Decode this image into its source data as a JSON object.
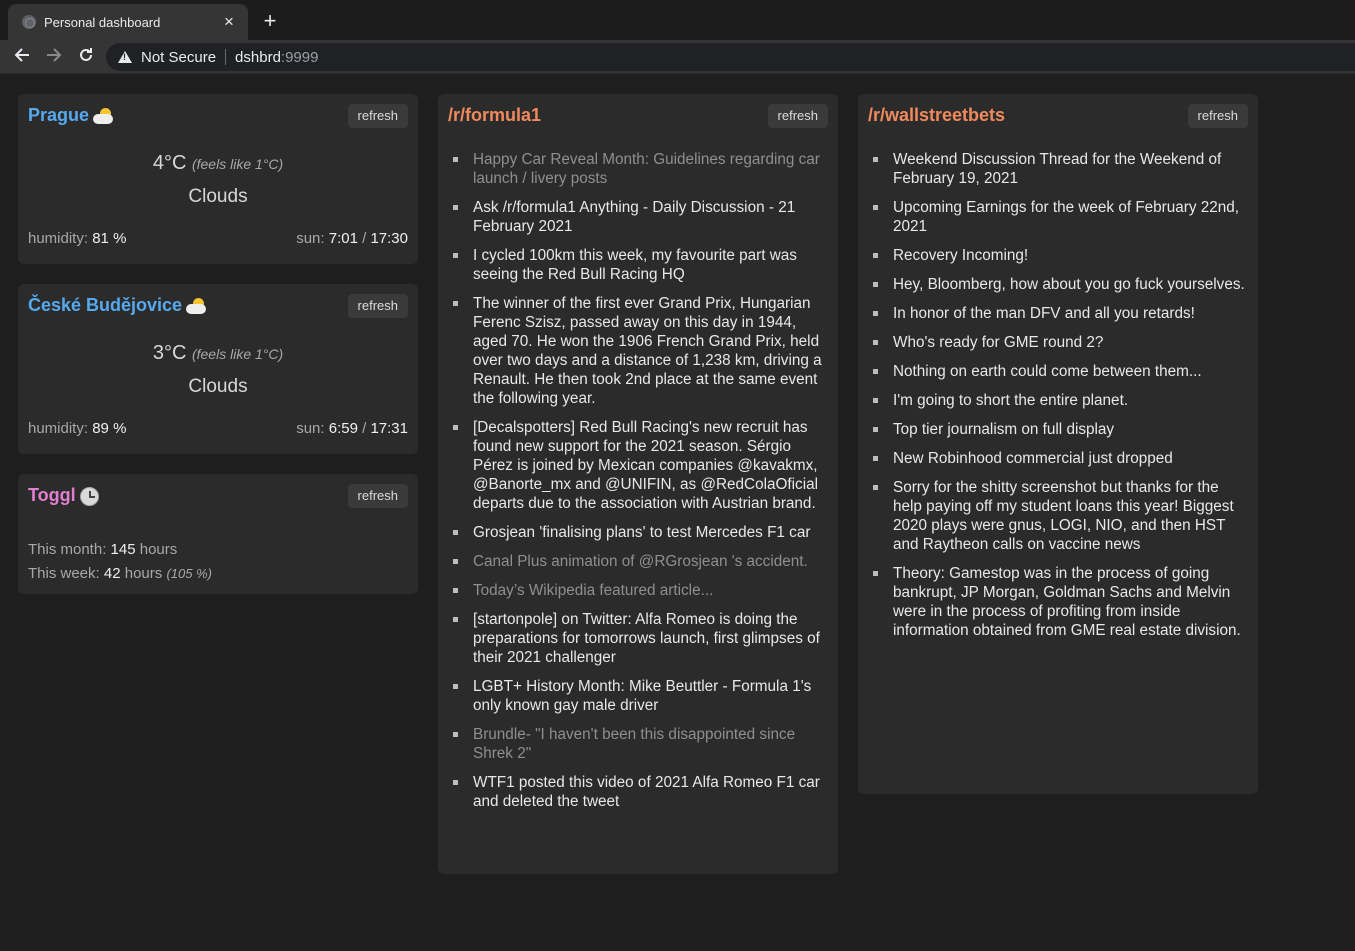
{
  "browser": {
    "tab_title": "Personal dashboard",
    "tab_close": "×",
    "new_tab": "+",
    "security_label": "Not Secure",
    "host": "dshbrd",
    "port": ":9999"
  },
  "weather": [
    {
      "city": "Prague",
      "icon": "sun-behind-cloud-icon",
      "refresh_label": "refresh",
      "temp": "4°C",
      "feels_like": "(feels like 1°C)",
      "condition": "Clouds",
      "humidity_label": "humidity:",
      "humidity_value": "81",
      "humidity_unit": "%",
      "sun_label": "sun:",
      "sunrise": "7:01",
      "sun_sep": "/",
      "sunset": "17:30"
    },
    {
      "city": "České Budějovice",
      "icon": "sun-behind-cloud-icon",
      "refresh_label": "refresh",
      "temp": "3°C",
      "feels_like": "(feels like 1°C)",
      "condition": "Clouds",
      "humidity_label": "humidity:",
      "humidity_value": "89",
      "humidity_unit": "%",
      "sun_label": "sun:",
      "sunrise": "6:59",
      "sun_sep": "/",
      "sunset": "17:31"
    }
  ],
  "toggl": {
    "title": "Toggl",
    "icon": "clock-icon",
    "refresh_label": "refresh",
    "month_label": "This month:",
    "month_value": "145",
    "month_unit": "hours",
    "week_label": "This week:",
    "week_value": "42",
    "week_unit": "hours",
    "week_percent": "(105 %)"
  },
  "subreddits": [
    {
      "title": "/r/formula1",
      "refresh_label": "refresh",
      "posts": [
        {
          "text": "Happy Car Reveal Month: Guidelines regarding car launch / livery posts",
          "muted": true
        },
        {
          "text": "Ask /r/formula1 Anything - Daily Discussion - 21 February 2021",
          "muted": false
        },
        {
          "text": "I cycled 100km this week, my favourite part was seeing the Red Bull Racing HQ",
          "muted": false
        },
        {
          "text": "The winner of the first ever Grand Prix, Hungarian Ferenc Szisz, passed away on this day in 1944, aged 70. He won the 1906 French Grand Prix, held over two days and a distance of 1,238 km, driving a Renault. He then took 2nd place at the same event the following year.",
          "muted": false
        },
        {
          "text": "[Decalspotters] Red Bull Racing's new recruit has found new support for the 2021 season. Sérgio Pérez is joined by Mexican companies @kavakmx, @Banorte_mx and @UNIFIN, as @RedColaOficial departs due to the association with Austrian brand.",
          "muted": false
        },
        {
          "text": "Grosjean 'finalising plans' to test Mercedes F1 car",
          "muted": false
        },
        {
          "text": "Canal Plus animation of @RGrosjean 's accident.",
          "muted": true
        },
        {
          "text": "Today’s Wikipedia featured article...",
          "muted": true
        },
        {
          "text": "[startonpole] on Twitter: Alfa Romeo is doing the preparations for tomorrows launch, first glimpses of their 2021 challenger",
          "muted": false
        },
        {
          "text": "LGBT+ History Month: Mike Beuttler - Formula 1's only known gay male driver",
          "muted": false
        },
        {
          "text": "Brundle- \"I haven't been this disappointed since Shrek 2\"",
          "muted": true
        },
        {
          "text": "WTF1 posted this video of 2021 Alfa Romeo F1 car and deleted the tweet",
          "muted": false
        }
      ]
    },
    {
      "title": "/r/wallstreetbets",
      "refresh_label": "refresh",
      "posts": [
        {
          "text": "Weekend Discussion Thread for the Weekend of February 19, 2021",
          "muted": false
        },
        {
          "text": "Upcoming Earnings for the week of February 22nd, 2021",
          "muted": false
        },
        {
          "text": "Recovery Incoming!",
          "muted": false
        },
        {
          "text": "Hey, Bloomberg, how about you go fuck yourselves.",
          "muted": false
        },
        {
          "text": "In honor of the man DFV and all you retards!",
          "muted": false
        },
        {
          "text": "Who's ready for GME round 2?",
          "muted": false
        },
        {
          "text": "Nothing on earth could come between them...",
          "muted": false
        },
        {
          "text": "I'm going to short the entire planet.",
          "muted": false
        },
        {
          "text": "Top tier journalism on full display",
          "muted": false
        },
        {
          "text": "New Robinhood commercial just dropped",
          "muted": false
        },
        {
          "text": "Sorry for the shitty screenshot but thanks for the help paying off my student loans this year! Biggest 2020 plays were gnus, LOGI, NIO, and then HST and Raytheon calls on vaccine news",
          "muted": false
        },
        {
          "text": "Theory: Gamestop was in the process of going bankrupt, JP Morgan, Goldman Sachs and Melvin were in the process of profiting from inside information obtained from GME real estate division.",
          "muted": false
        }
      ]
    }
  ]
}
